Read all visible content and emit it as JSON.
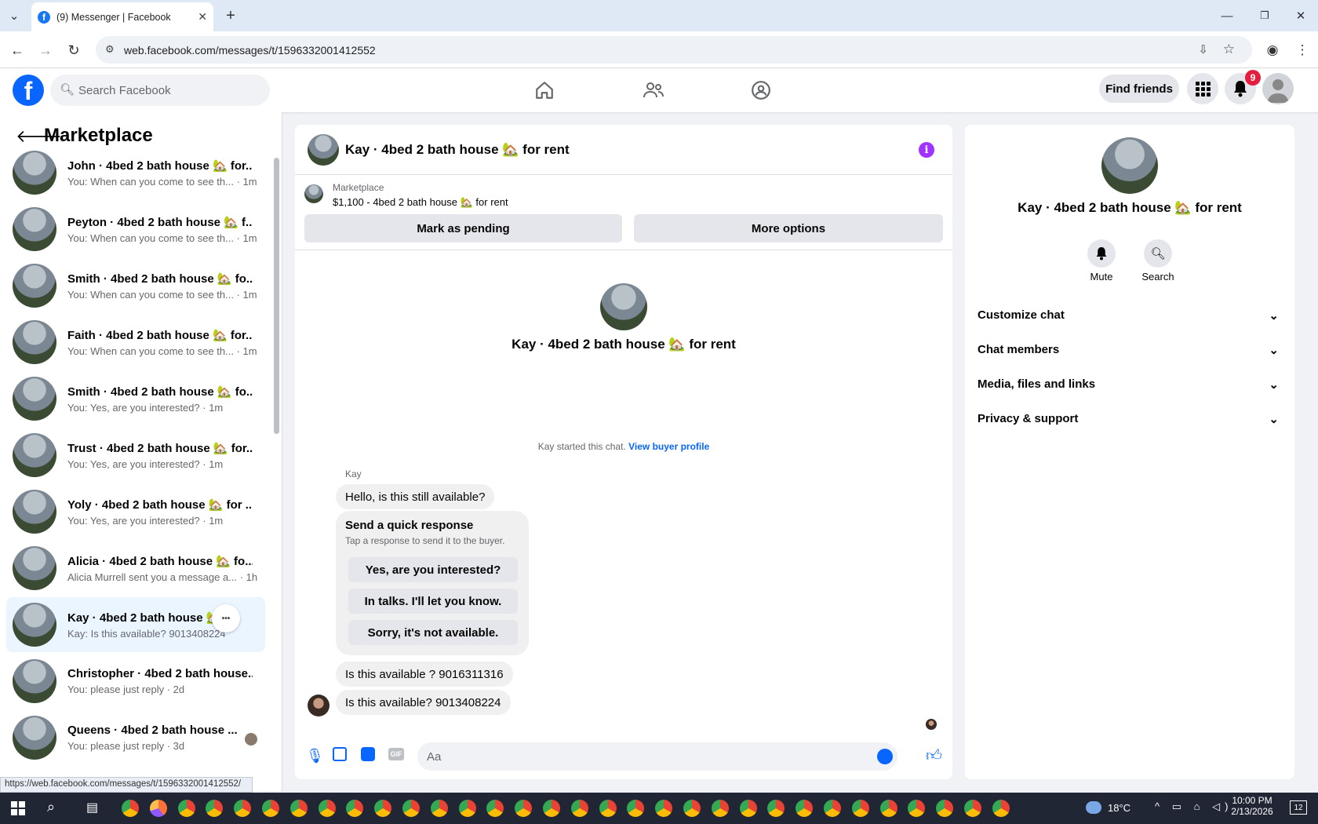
{
  "browser": {
    "tab_title": "(9) Messenger | Facebook",
    "url": "web.facebook.com/messages/t/1596332001412552",
    "status_url": "https://web.facebook.com/messages/t/1596332001412552/"
  },
  "fb": {
    "search_placeholder": "Search Facebook",
    "find_friends": "Find friends",
    "notification_count": "9"
  },
  "sidebar": {
    "title": "Marketplace",
    "conversations": [
      {
        "name": "John · 4bed 2 bath house 🏡 for...",
        "preview": "You: When can you come to see th... · 1m"
      },
      {
        "name": "Peyton · 4bed 2 bath house 🏡 f...",
        "preview": "You: When can you come to see th... · 1m"
      },
      {
        "name": "Smith · 4bed 2 bath house 🏡 fo...",
        "preview": "You: When can you come to see th... · 1m"
      },
      {
        "name": "Faith · 4bed 2 bath house 🏡 for...",
        "preview": "You: When can you come to see th... · 1m"
      },
      {
        "name": "Smith · 4bed 2 bath house 🏡 fo...",
        "preview": "You: Yes, are you interested? · 1m"
      },
      {
        "name": "Trust · 4bed 2 bath house 🏡 for...",
        "preview": "You: Yes, are you interested? · 1m"
      },
      {
        "name": "Yoly · 4bed 2 bath house 🏡 for ...",
        "preview": "You: Yes, are you interested? · 1m"
      },
      {
        "name": "Alicia · 4bed 2 bath house 🏡 fo...",
        "preview": "Alicia Murrell sent you a message a... · 1h"
      },
      {
        "name": "Kay · 4bed 2 bath house 🏡 f...",
        "preview": "Kay: Is this available? 9013408224"
      },
      {
        "name": "Christopher · 4bed 2 bath house...",
        "preview": "You: please just reply · 2d"
      },
      {
        "name": "Queens · 4bed 2 bath house ...",
        "preview": "You: please just reply · 3d"
      }
    ]
  },
  "chat": {
    "title": "Kay · 4bed 2 bath house 🏡 for rent",
    "listing_source": "Marketplace",
    "listing_info": "$1,100 - 4bed 2 bath house 🏡 for rent",
    "mark_pending": "Mark as pending",
    "more_options": "More options",
    "intro_name": "Kay · 4bed 2 bath house 🏡 for rent",
    "started_text": "Kay started this chat.",
    "view_profile": "View buyer profile",
    "sender": "Kay",
    "msg1": "Hello, is this still available?",
    "qr_title": "Send a quick response",
    "qr_sub": "Tap a response to send it to the buyer.",
    "qr1": "Yes, are you interested?",
    "qr2": "In talks. I'll let you know.",
    "qr3": "Sorry, it's not available.",
    "msg2": "Is this available ? 9016311316",
    "msg3": "Is this available? 9013408224",
    "composer_placeholder": "Aa"
  },
  "details": {
    "name": "Kay · 4bed 2 bath house 🏡 for rent",
    "mute": "Mute",
    "search": "Search",
    "sections": [
      "Customize chat",
      "Chat members",
      "Media, files and links",
      "Privacy & support"
    ]
  },
  "taskbar": {
    "temperature": "18°C",
    "time": "10:00 PM",
    "date": "2/13/2026",
    "notif_count": "12"
  },
  "colors": {
    "fb_blue": "#0866ff",
    "messenger_purple": "#a033ff",
    "badge_red": "#e41e3f"
  }
}
